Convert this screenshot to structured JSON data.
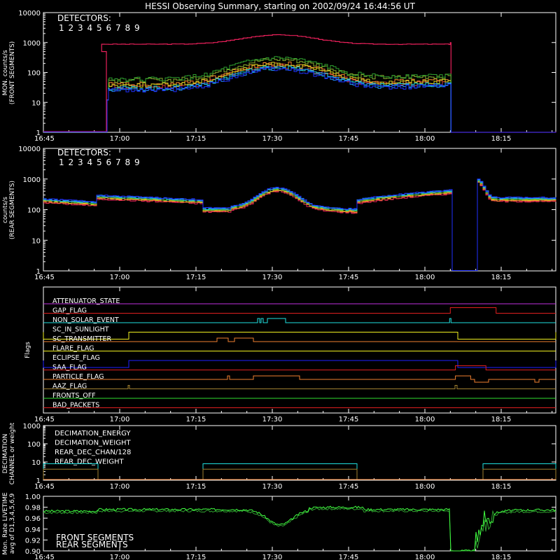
{
  "title": "HESSI Observing Summary, starting on 2002/09/24 16:44:56 UT",
  "time_ticks": [
    "16:45",
    "17:00",
    "17:15",
    "17:30",
    "17:45",
    "18:00",
    "18:15"
  ],
  "colors": {
    "d1": "#e8205a",
    "d2": "#d84040",
    "d3": "#ff8a30",
    "d4": "#d8d820",
    "d5": "#8ab030",
    "d6": "#2ea02e",
    "d7": "#20d8d8",
    "d8": "#2090ff",
    "d9": "#2030ff",
    "magenta": "#c030e0",
    "red": "#e02020",
    "cyan": "#20e0e0",
    "orange": "#f08030",
    "yellow": "#f0f020",
    "blue": "#2020ff",
    "olive": "#a08030",
    "green": "#30e030",
    "bright_green": "#40ff40",
    "dark_green": "#30a030"
  },
  "front_panel": {
    "ylabel_lines": [
      "MON. counts/s",
      "(FRONT SEGMENTS)"
    ],
    "yticks": [
      "1",
      "10",
      "100",
      "1000",
      "10000"
    ],
    "legend_title": "DETECTORS:",
    "detectors": [
      "1",
      "2",
      "3",
      "4",
      "5",
      "6",
      "7",
      "8",
      "9"
    ]
  },
  "rear_panel": {
    "ylabel_lines": [
      "counts/s",
      "(REAR SEGMENTS)"
    ],
    "yticks": [
      "1",
      "10",
      "100",
      "1000",
      "10000"
    ],
    "legend_title": "DETECTORS:",
    "detectors": [
      "1",
      "2",
      "3",
      "4",
      "5",
      "6",
      "7",
      "8",
      "9"
    ]
  },
  "flags_panel": {
    "ylabel": "Flags",
    "flags": [
      {
        "name": "ATTENUATOR_STATE",
        "color": "magenta"
      },
      {
        "name": "GAP_FLAG",
        "color": "red"
      },
      {
        "name": "NON_SOLAR_EVENT",
        "color": "cyan"
      },
      {
        "name": "SC_IN_SUNLIGHT",
        "color": "yellow"
      },
      {
        "name": "SC_TRANSMITTER",
        "color": "orange"
      },
      {
        "name": "FLARE_FLAG",
        "color": "yellow"
      },
      {
        "name": "ECLIPSE_FLAG",
        "color": "blue"
      },
      {
        "name": "SAA_FLAG",
        "color": "red"
      },
      {
        "name": "PARTICLE_FLAG",
        "color": "orange"
      },
      {
        "name": "AAZ_FLAG",
        "color": "olive"
      },
      {
        "name": "FRONTS_OFF",
        "color": "green"
      },
      {
        "name": "BAD_PACKETS",
        "color": "red"
      }
    ]
  },
  "decim_panel": {
    "ylabel_lines": [
      "DECIMATION",
      "CHANNEL or weight"
    ],
    "yticks": [
      "1",
      "10",
      "100",
      "1000"
    ],
    "legend": [
      {
        "name": "DECIMATION_ENERGY",
        "color": "bright_green"
      },
      {
        "name": "DECIMATION_WEIGHT",
        "color": "orange"
      },
      {
        "name": "REAR_DEC_CHAN/128",
        "color": "cyan"
      },
      {
        "name": "REAR_DEC_WEIGHT",
        "color": "olive"
      }
    ]
  },
  "livetime_panel": {
    "ylabel_lines": [
      "Mon. Rate LIVETIME",
      "avg of D1,3,4,5,6,9"
    ],
    "yticks": [
      "0.90",
      "0.92",
      "0.94",
      "0.96",
      "0.98",
      "1.00"
    ],
    "legend": [
      {
        "name": "FRONT SEGMENTS",
        "color": "bright_green"
      },
      {
        "name": "REAR SEGMENTS",
        "color": "dark_green"
      }
    ]
  },
  "chart_data": {
    "type": "line",
    "x_range": [
      "16:44:56",
      "18:28:00"
    ],
    "panels": [
      {
        "name": "front",
        "y_scale": "log",
        "ylim": [
          1,
          10000
        ],
        "approx_series": [
          {
            "name": "1",
            "segments": [
              {
                "from": "16:56",
                "to": "18:05",
                "base": 900,
                "peak": 1800,
                "peak_at": "17:30"
              }
            ]
          },
          {
            "name": "2-9",
            "segments": [
              {
                "from": "16:56",
                "to": "18:05",
                "base": 35,
                "peak": 180,
                "peak_at": "17:30"
              }
            ]
          }
        ]
      },
      {
        "name": "rear",
        "y_scale": "log",
        "ylim": [
          1,
          10000
        ],
        "approx_series": [
          {
            "name": "1-9",
            "segments": [
              {
                "from": "16:45",
                "to": "18:05",
                "base": 180,
                "peak": 500,
                "peak_at": "17:31"
              },
              {
                "from": "18:10",
                "to": "18:28",
                "base": 200,
                "peak": 900,
                "peak_at": "18:11"
              }
            ]
          }
        ]
      },
      {
        "name": "decimation",
        "y_scale": "log",
        "ylim": [
          1,
          1000
        ],
        "approx_series": [
          {
            "name": "REAR_DEC_CHAN/128",
            "values_on": 8,
            "on_intervals": [
              [
                "16:45",
                "16:58"
              ],
              [
                "17:16",
                "17:46"
              ],
              [
                "18:11",
                "18:28"
              ]
            ]
          },
          {
            "name": "REAR_DEC_WEIGHT",
            "values_on": 4,
            "on_intervals": [
              [
                "16:45",
                "16:58"
              ],
              [
                "17:16",
                "17:46"
              ],
              [
                "18:11",
                "18:28"
              ]
            ]
          }
        ]
      },
      {
        "name": "livetime",
        "y_scale": "linear",
        "ylim": [
          0.9,
          1.0
        ],
        "approx_series": [
          {
            "name": "FRONT SEGMENTS",
            "baseline": 0.975,
            "min": 0.948,
            "min_at": "17:32"
          },
          {
            "name": "REAR SEGMENTS",
            "baseline": 0.972,
            "min": 0.945,
            "min_at": "17:32"
          }
        ]
      }
    ]
  }
}
